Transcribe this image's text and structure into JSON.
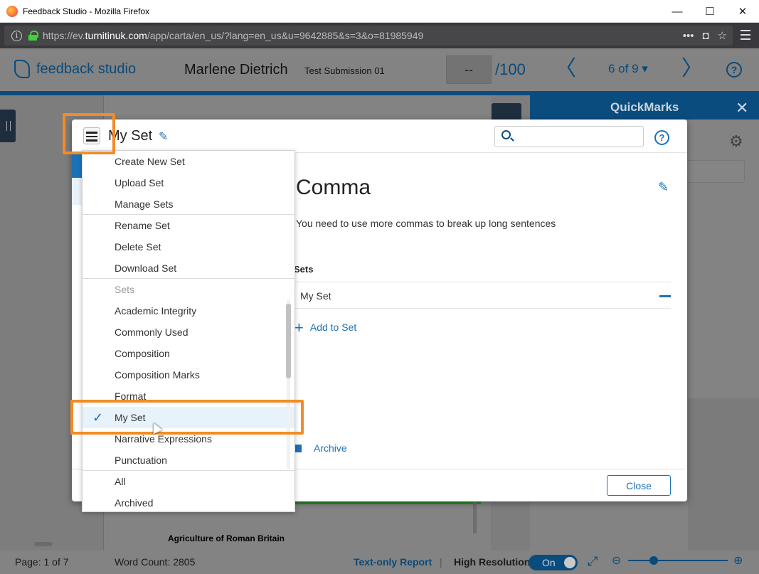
{
  "window": {
    "title": "Feedback Studio - Mozilla Firefox",
    "minimize": "—",
    "maximize": "☐",
    "close": "✕"
  },
  "browser": {
    "url_prefix": "https://ev.",
    "url_domain": "turnitinuk.com",
    "url_path": "/app/carta/en_us/?lang=en_us&u=9642885&s=3&o=81985949",
    "info": "i",
    "more": "•••",
    "pocket": "◘",
    "bookmark": "☆"
  },
  "app": {
    "logo_text": "feedback studio",
    "student_name": "Marlene Dietrich",
    "submission_title": "Test Submission 01",
    "score": "--",
    "score_max": "/100",
    "prev": "〈",
    "next": "〉",
    "pager": "6 of 9 ▾",
    "help": "?"
  },
  "quickmarks_panel": {
    "title": "QuickMarks",
    "close": "✕",
    "gear": "⚙"
  },
  "dialog": {
    "set_title": "My Set",
    "edit_icon": "✎",
    "search_placeholder": "",
    "help": "?",
    "quickmark_name": "Comma",
    "quickmark_description": "You need to use more commas to break up long sentences",
    "sets_label": "Sets",
    "sets": [
      {
        "name": "My Set"
      }
    ],
    "add_to_set": "Add to Set",
    "add_plus": "+",
    "archive": "Archive",
    "close_button": "Close"
  },
  "menu": {
    "group_actions_1": [
      "Create New Set",
      "Upload Set",
      "Manage Sets"
    ],
    "group_actions_2": [
      "Rename Set",
      "Delete Set",
      "Download Set"
    ],
    "sets_header": "Sets",
    "set_items": [
      "Academic Integrity",
      "Commonly Used",
      "Composition",
      "Composition Marks",
      "Format",
      "My Set",
      "Narrative Expressions",
      "Punctuation"
    ],
    "selected_set": "My Set",
    "check": "✓",
    "group_filters": [
      "All",
      "Archived"
    ]
  },
  "document": {
    "title": "Agriculture of Roman Britain"
  },
  "statusbar": {
    "page": "Page: 1 of 7",
    "word_count": "Word Count: 2805",
    "text_only": "Text-only Report",
    "divider": "|",
    "high_res": "High Resolution",
    "toggle": "On",
    "expand": "⤢",
    "zoom_out": "⊖",
    "zoom_in": "⊕"
  }
}
